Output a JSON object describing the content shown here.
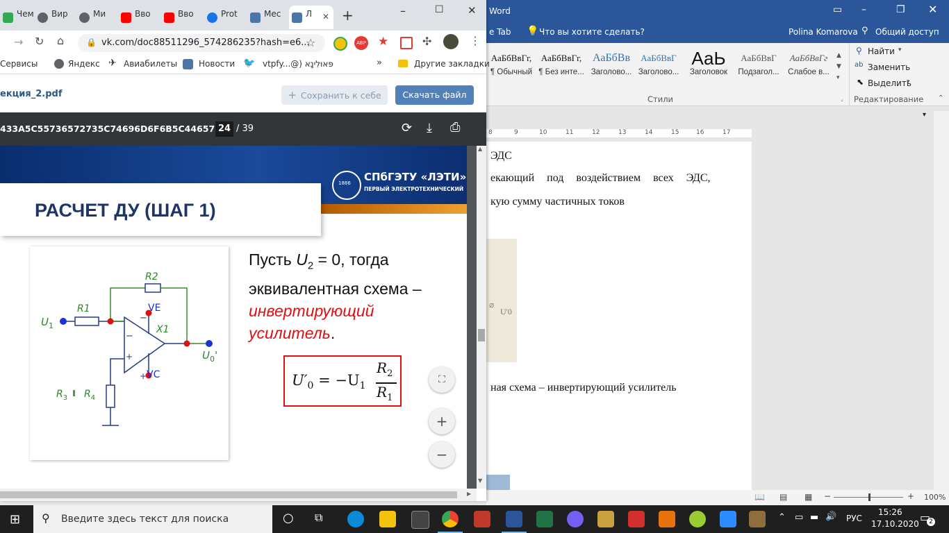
{
  "word": {
    "title_suffix": "Word",
    "tab_partial": "e Tab",
    "tell_me": "Что вы хотите сделать?",
    "user": "Polina Komarova",
    "share": "Общий доступ",
    "styles": [
      {
        "sample": "АаБбВвГг,",
        "name": "¶ Обычный"
      },
      {
        "sample": "АаБбВвГг,",
        "name": "¶ Без инте..."
      },
      {
        "sample": "АаБбВв",
        "name": "Заголово..."
      },
      {
        "sample": "АаБбВвГ",
        "name": "Заголово..."
      },
      {
        "sample": "АаЬ",
        "name": "Заголовок"
      },
      {
        "sample": "АаБбВвГ",
        "name": "Подзагол..."
      },
      {
        "sample": "АаБбВвГг",
        "name": "Слабое в..."
      }
    ],
    "styles_group_label": "Стили",
    "editing": {
      "find": "Найти",
      "replace": "Заменить",
      "select": "Выделить",
      "group_label": "Редактирование"
    },
    "ruler_numbers": [
      "8",
      "9",
      "10",
      "11",
      "12",
      "13",
      "14",
      "15",
      "16",
      "17"
    ],
    "doc_lines": [
      "ЭДС",
      "екающий под воздействием всех ЭДС,",
      "кую сумму частичных токов",
      "ная схема – инвертирующий усилитель"
    ],
    "figure_label": "U'0",
    "zoom": "100%"
  },
  "chrome": {
    "tabs": [
      {
        "label": "Чем",
        "color": "#34a853"
      },
      {
        "label": "Вир",
        "color": "#5f6368"
      },
      {
        "label": "Ми",
        "color": "#5f6368"
      },
      {
        "label": "Вво",
        "color": "#ff0000"
      },
      {
        "label": "Вво",
        "color": "#ff0000"
      },
      {
        "label": "Prot",
        "color": "#1a73e8"
      },
      {
        "label": "Мес",
        "color": "#4a76a8"
      },
      {
        "label": "Л",
        "color": "#4a76a8"
      }
    ],
    "new_tab": "+",
    "url": "vk.com/doc88511296_574286235?hash=e6...",
    "bookmarks": [
      "Сервисы",
      "Яндекс",
      "Авиабилеты",
      "Новости",
      "vtpfy...@) פּאוּלִינָא",
      "Другие закладки"
    ],
    "bookmarks_more": "»"
  },
  "vk": {
    "filename": "екция_2.pdf",
    "save_button": "Сохранить к себе",
    "download_button": "Скачать файл"
  },
  "pdf": {
    "doc_title": "433A5C55736572735C74696D6F6B5C446573...",
    "page_current": "24",
    "page_total": "/ 39"
  },
  "slide": {
    "logo_title": "СПбГЭТУ «ЛЭТИ»",
    "logo_subtitle": "ПЕРВЫЙ ЭЛЕКТРОТЕХНИЧЕСКИЙ",
    "logo_year": "1886",
    "heading": "РАСЧЕТ ДУ (ШАГ 1)",
    "text_line1_prefix": "Пусть ",
    "text_var": "U",
    "text_sub": "2",
    "text_line1_suffix": " = 0, тогда",
    "text_line2": "эквивалентная схема –",
    "text_red1": "инвертирующий",
    "text_red2": "усилитель",
    "text_dot": ".",
    "formula_lhs": "U′",
    "formula_lhs_sub": "0",
    "formula_eq": " = −U",
    "formula_eq_sub": "1",
    "formula_num": "R",
    "formula_num_sub": "2",
    "formula_den": "R",
    "formula_den_sub": "1",
    "circuit": {
      "r2": "R2",
      "r1": "R1",
      "u1": "U",
      "u1_sub": "1",
      "ve": "VE",
      "x1": "X1",
      "minus": "−",
      "plus": "+",
      "vc": "VC",
      "u0": "U",
      "u0_sub": "0",
      "u0_prime": "'",
      "r3": "R",
      "r3_sub": "3",
      "r4": "R",
      "r4_sub": "4"
    }
  },
  "taskbar": {
    "search_placeholder": "Введите здесь текст для поиска",
    "lang": "РУС",
    "time": "15:26",
    "date": "17.10.2020",
    "notifications": "2"
  }
}
